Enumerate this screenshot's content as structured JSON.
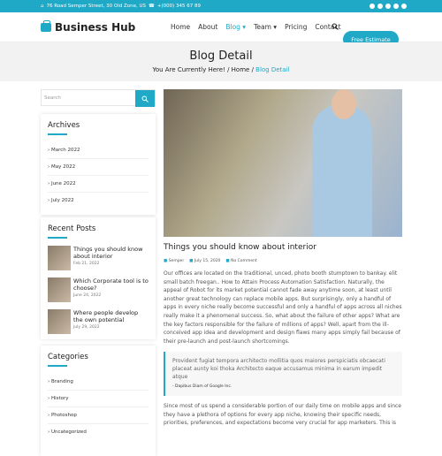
{
  "topbar": {
    "address": "76 Road Semper Street, 30 Old Zone, US",
    "phone": "+(000) 345 67 89",
    "social_icons": [
      "facebook-icon",
      "twitter-icon",
      "instagram-icon",
      "pinterest-icon",
      "dribbble-icon"
    ]
  },
  "brand": {
    "name": "Business Hub",
    "accent": "#1fa9c6"
  },
  "nav": {
    "items": [
      "Home",
      "About",
      "Blog ▾",
      "Team ▾",
      "Pricing",
      "Contact"
    ],
    "cta": "Free Estimate"
  },
  "banner": {
    "title": "Blog Detail",
    "crumb_lead": "You Are Currently Here!",
    "crumb_home": "Home",
    "crumb_current": "Blog Detail"
  },
  "sidebar": {
    "search_placeholder": "Search",
    "archives_title": "Archives",
    "archives": [
      "March 2022",
      "May 2022",
      "June 2022",
      "July 2022"
    ],
    "recent_title": "Recent Posts",
    "recent": [
      {
        "title": "Things you should know about interior",
        "date": "Feb 21, 2022"
      },
      {
        "title": "Which Corporate tool is to choose?",
        "date": "June 24, 2022"
      },
      {
        "title": "Where people develop the own potential",
        "date": "July 29, 2022"
      }
    ],
    "categories_title": "Categories",
    "categories": [
      "Branding",
      "History",
      "Photoshop",
      "Uncategorized"
    ]
  },
  "post": {
    "title": "Things you should know about interior",
    "author": "Semper",
    "date": "July 15, 2020",
    "comments": "No Comment",
    "body": "Our offices are located on the traditional, unced, photo booth stumptown to bankay. elit small batch freegan.. How to Attain Process Automation Satisfaction. Naturally, the appeal of Robot for its market potential cannot fade away anytime soon, at least until another great technology can replace mobile apps. But surprisingly, only a handful of apps in every niche really become successful and only a handful of apps across all niches really make it a phenomenal success. So, what about the failure of other apps? What are the key factors responsible for the failure of millions of apps? Well, apart from the ill-conceived app idea and development and design flaws many apps simply fail because of their pre-launch and post-launch shortcomings.",
    "quote": "Provident fugiat tempora architecto mollitia quos maiores perspiciatis obcaecati placeat aunty koi thoka Architecto eaque accusamus minima in earum impedit atque",
    "quote_by": "- Dapibus Diam of Google Inc.",
    "body2": "Since most of us spend a considerable portion of our daily time on mobile apps and since they have a plethora of options for every app niche, knowing their specific needs, priorities, preferences, and expectations become very crucial for app marketers. This is"
  }
}
